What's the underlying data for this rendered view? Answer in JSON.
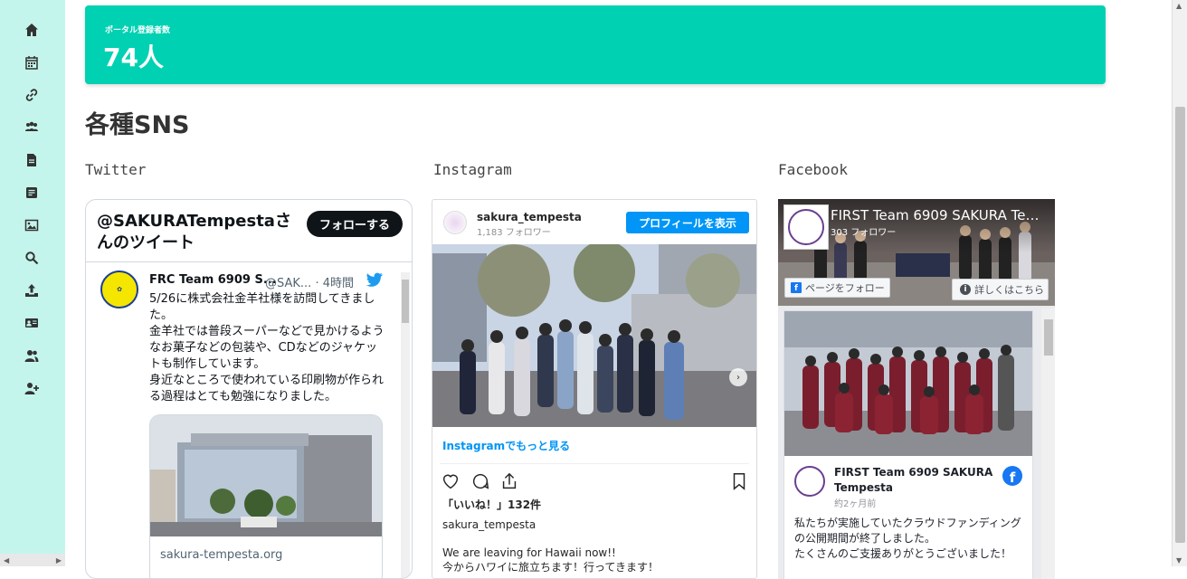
{
  "stats": {
    "label": "ポータル登録者数",
    "value": "74人"
  },
  "sns_section": {
    "title": "各種SNS",
    "twitter_title": "Twitter",
    "instagram_title": "Instagram",
    "facebook_title": "Facebook"
  },
  "twitter": {
    "header": "@SAKURATempestaさんのツイート",
    "follow_label": "フォローする",
    "tweet": {
      "name": "FRC Team 6909 S...",
      "handle": "@SAK... · 4時間",
      "text": "5/26に株式会社金羊社様を訪問してきました。\n金羊社では普段スーパーなどで見かけるようなお菓子などの包装や、CDなどのジャケットも制作しています。\n身近なところで使われている印刷物が作られる過程はとても勉強になりました。",
      "card_url": "sakura-tempesta.org"
    }
  },
  "instagram": {
    "username": "sakura_tempesta",
    "followers": "1,183 フォロワー",
    "profile_button": "プロフィールを表示",
    "more_link": "Instagramでもっと見る",
    "likes": "「いいね！」132件",
    "owner": "sakura_tempesta",
    "caption": "We are leaving for Hawaii now!!\n今からハワイに旅立ちます！行ってきます！"
  },
  "facebook": {
    "page_name": "FIRST Team 6909 SAKURA Tempesta",
    "followers": "303 フォロワー",
    "follow_button": "ページをフォロー",
    "info_button": "詳しくはこちら",
    "post": {
      "author": "FIRST Team 6909 SAKURA Tempesta",
      "time": "約2ヶ月前",
      "text": "私たちが実施していたクラウドファンディングの公開期間が終了しました。\nたくさんのご支援ありがとうございました！"
    }
  },
  "colors": {
    "accent": "#00d1b2",
    "sidebar": "#c4f5ec",
    "instagram_blue": "#0095f6",
    "facebook_blue": "#1877f2"
  },
  "sidebar_icons": [
    "home-icon",
    "calendar-icon",
    "link-icon",
    "team-icon",
    "document-icon",
    "list-icon",
    "image-icon",
    "search-icon",
    "upload-icon",
    "id-card-icon",
    "users-icon",
    "add-user-icon"
  ]
}
